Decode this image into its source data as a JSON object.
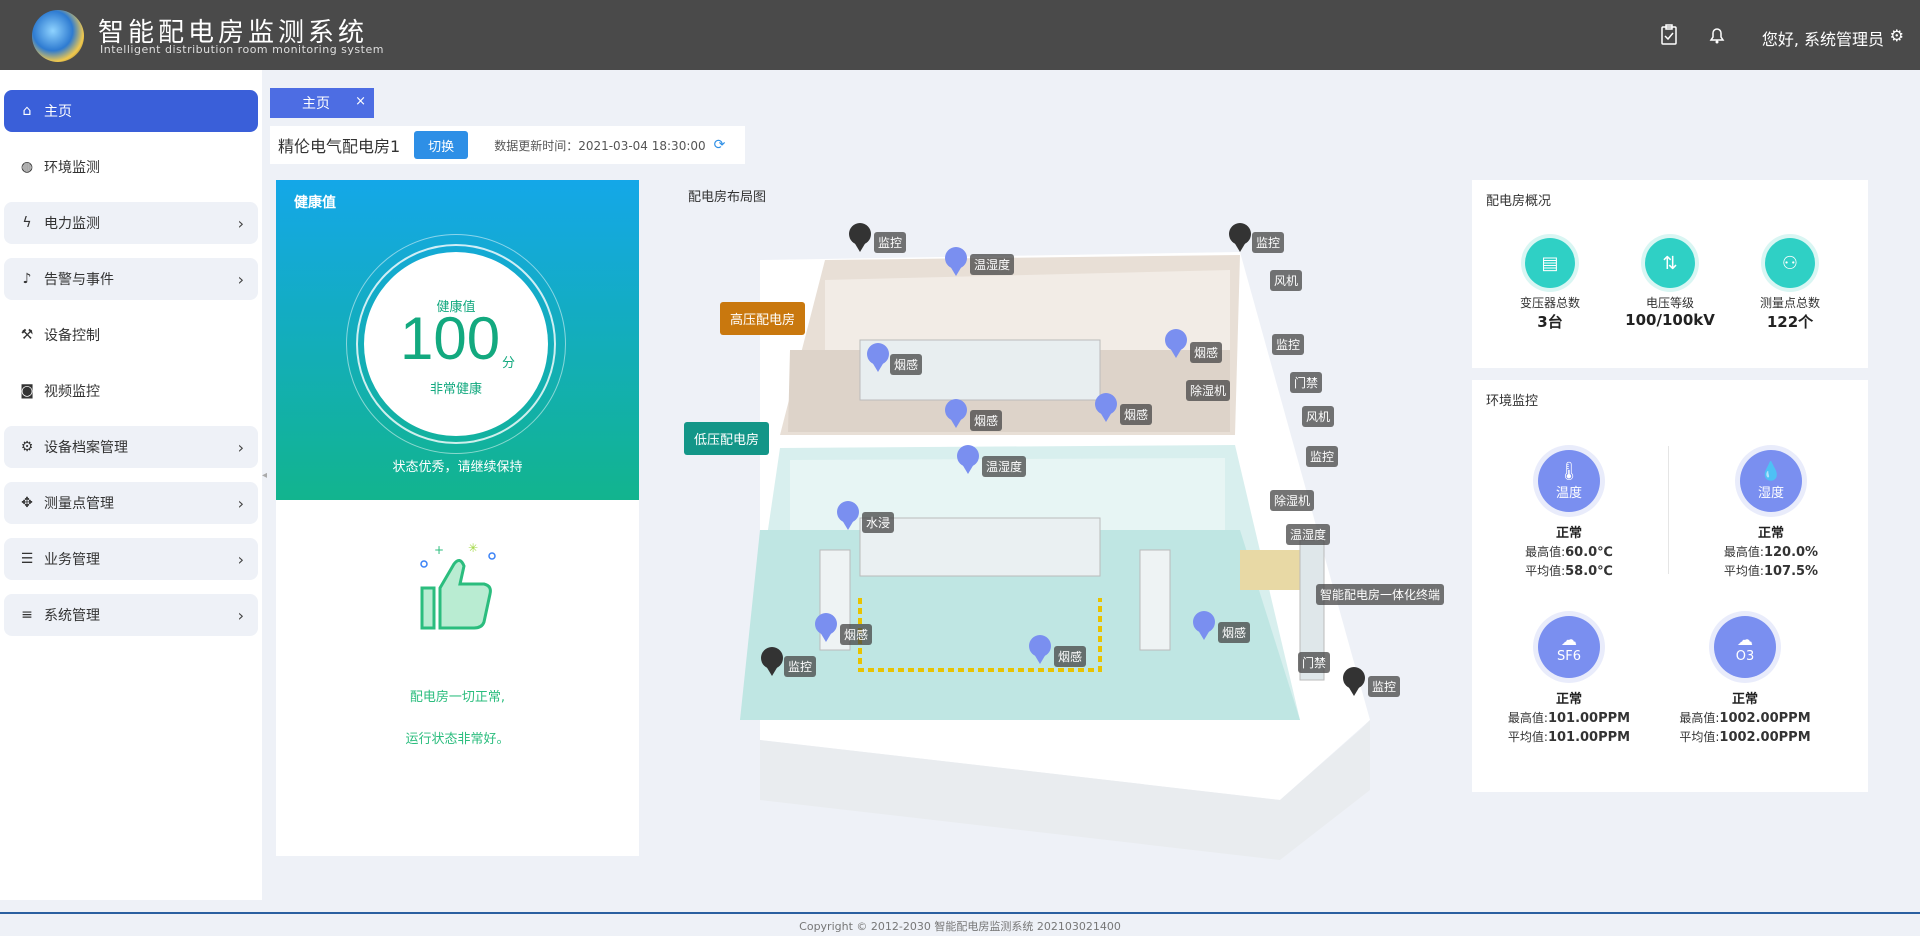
{
  "header": {
    "title": "智能配电房监测系统",
    "subtitle": "Intelligent distribution room monitoring system",
    "greeting": "您好, 系统管理员"
  },
  "sidebar": {
    "items": [
      {
        "label": "主页",
        "icon": "home-icon"
      },
      {
        "label": "环境监测",
        "icon": "globe-icon"
      },
      {
        "label": "电力监测",
        "icon": "bolt-icon"
      },
      {
        "label": "告警与事件",
        "icon": "bell-icon"
      },
      {
        "label": "设备控制",
        "icon": "wrench-icon"
      },
      {
        "label": "视频监控",
        "icon": "camera-icon"
      },
      {
        "label": "设备档案管理",
        "icon": "gear-icon"
      },
      {
        "label": "测量点管理",
        "icon": "crosshair-icon"
      },
      {
        "label": "业务管理",
        "icon": "server-icon"
      },
      {
        "label": "系统管理",
        "icon": "list-icon"
      }
    ]
  },
  "tabs": {
    "home": "主页"
  },
  "room_bar": {
    "name": "精伦电气配电房1",
    "switch": "切换",
    "update_time": "数据更新时间：2021-03-04 18:30:00"
  },
  "health": {
    "title": "健康值",
    "label": "健康值",
    "value": "100",
    "unit": "分",
    "status": "非常健康",
    "message": "状态优秀，请继续保持",
    "text1": "配电房一切正常,",
    "text2": "运行状态非常好。"
  },
  "map": {
    "title": "配电房布局图",
    "high_room": "高压配电房",
    "low_room": "低压配电房",
    "tags": {
      "monitor": "监控",
      "temp_hum": "温湿度",
      "smoke": "烟感",
      "fan": "风机",
      "dehum": "除湿机",
      "door": "门禁",
      "water": "水浸",
      "terminal": "智能配电房一体化终端"
    }
  },
  "overview": {
    "title": "配电房概况",
    "items": [
      {
        "label": "变压器总数",
        "value": "3台"
      },
      {
        "label": "电压等级",
        "value": "100/100kV"
      },
      {
        "label": "测量点总数",
        "value": "122个"
      }
    ]
  },
  "env": {
    "title": "环境监控",
    "items": [
      {
        "name": "温度",
        "status": "正常",
        "max_label": "最高值:",
        "max": "60.0℃",
        "avg_label": "平均值:",
        "avg": "58.0℃"
      },
      {
        "name": "湿度",
        "status": "正常",
        "max_label": "最高值:",
        "max": "120.0%",
        "avg_label": "平均值:",
        "avg": "107.5%"
      },
      {
        "name": "SF6",
        "status": "正常",
        "max_label": "最高值:",
        "max": "101.00PPM",
        "avg_label": "平均值:",
        "avg": "101.00PPM"
      },
      {
        "name": "O3",
        "status": "正常",
        "max_label": "最高值:",
        "max": "1002.00PPM",
        "avg_label": "平均值:",
        "avg": "1002.00PPM"
      }
    ]
  },
  "footer": "Copyright © 2012-2030 智能配电房监测系统 202103021400",
  "colors": {
    "accent": "#3a5fd9",
    "health": "#13a97f",
    "high_room": "#c9780e",
    "low_room": "#139688"
  }
}
